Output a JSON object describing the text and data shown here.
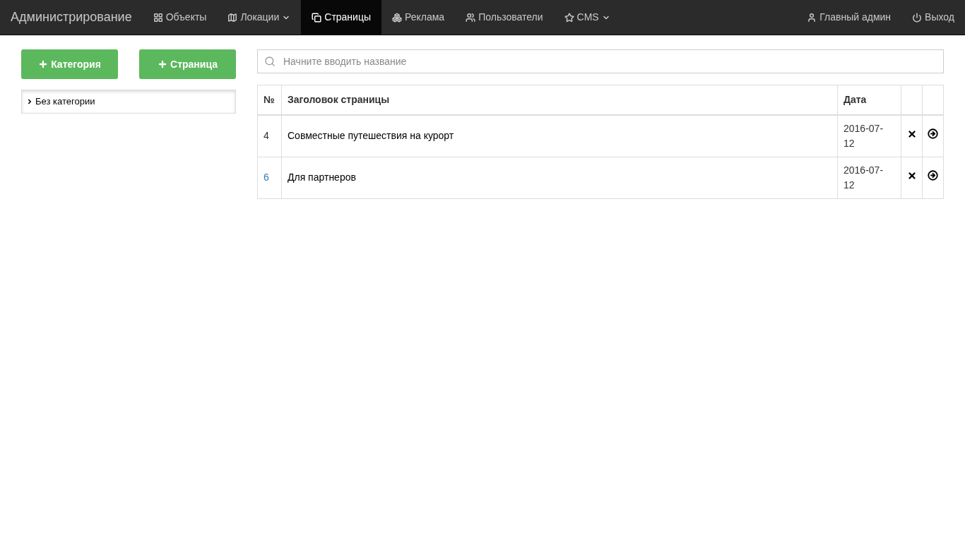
{
  "navbar": {
    "brand": "Администрирование",
    "items": [
      {
        "label": "Объекты",
        "dropdown": false,
        "selected": false
      },
      {
        "label": "Локации",
        "dropdown": true,
        "selected": false
      },
      {
        "label": "Страницы",
        "dropdown": false,
        "selected": true
      },
      {
        "label": "Реклама",
        "dropdown": false,
        "selected": false
      },
      {
        "label": "Пользователи",
        "dropdown": false,
        "selected": false
      },
      {
        "label": "CMS",
        "dropdown": true,
        "selected": false
      }
    ],
    "right": [
      {
        "label": "Главный админ"
      },
      {
        "label": "Выход"
      }
    ]
  },
  "buttons": [
    {
      "label": "Категория"
    },
    {
      "label": "Страница"
    }
  ],
  "categories": [
    {
      "label": "Без категории",
      "expanded": false
    }
  ],
  "search": {
    "placeholder": "Начните вводить название"
  },
  "table": {
    "columns": [
      "№",
      "Заголовок страницы",
      "Дата"
    ],
    "rows": [
      {
        "number": "4",
        "title": "Совместные путешествия на курорт",
        "date": "2016-07-12",
        "link": false
      },
      {
        "number": "6",
        "title": "Для партнеров",
        "date": "2016-07-12",
        "link": true
      }
    ]
  }
}
